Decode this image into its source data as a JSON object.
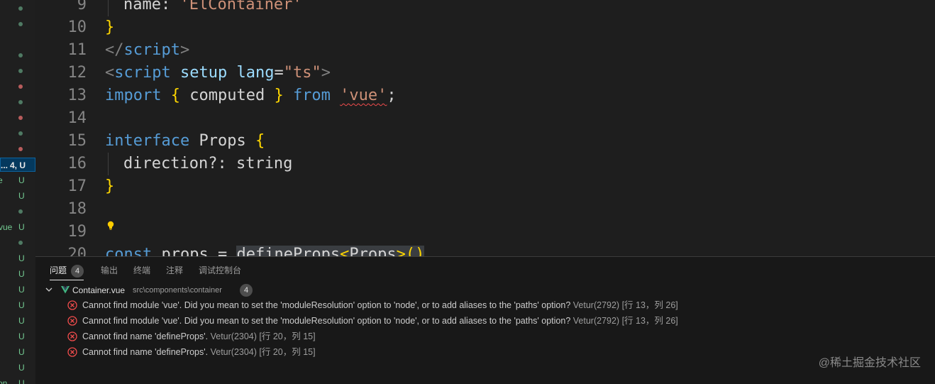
{
  "explorer": {
    "active_item": {
      "name_fragment": "...",
      "status": "4, U"
    },
    "name_fragments": {
      "e": "e",
      "vue": "vue",
      "on": "on"
    },
    "status_u": "U",
    "colors": {
      "untracked": "#73c991",
      "error": "#b85c5c",
      "ok": "#4f7a63"
    }
  },
  "editor": {
    "lines": [
      {
        "n": "9"
      },
      {
        "n": "10"
      },
      {
        "n": "11"
      },
      {
        "n": "12"
      },
      {
        "n": "13"
      },
      {
        "n": "14"
      },
      {
        "n": "15"
      },
      {
        "n": "16"
      },
      {
        "n": "17"
      },
      {
        "n": "18"
      },
      {
        "n": "19"
      },
      {
        "n": "20"
      }
    ],
    "code": {
      "l9_key": "name",
      "l9_colon": ": ",
      "l9_val": "'ElContainer'",
      "l10": "}",
      "l11_open": "</",
      "l11_tag": "script",
      "l11_close": ">",
      "l12_open": "<",
      "l12_tag": "script",
      "l12_attr1": "setup",
      "l12_attr2": "lang",
      "l12_eq": "=",
      "l12_val": "\"ts\"",
      "l12_close": ">",
      "l13_import": "import",
      "l13_lb": "{",
      "l13_name": " computed ",
      "l13_rb": "}",
      "l13_from": "from",
      "l13_mod": "'vue'",
      "l13_semi": ";",
      "l15_kw": "interface",
      "l15_name": "Props",
      "l15_lb": "{",
      "l16_key": "direction?",
      "l16_colon": ": ",
      "l16_type": "string",
      "l17": "}",
      "l20_const": "const",
      "l20_name": "props",
      "l20_eq": " = ",
      "l20_fn": "defineProps",
      "l20_lt": "<",
      "l20_type": "Props",
      "l20_gt": ">",
      "l20_parens": "()"
    },
    "lightbulb_icon": "lightbulb-icon"
  },
  "panel": {
    "tabs": [
      {
        "label": "问题",
        "count": "4",
        "active": true
      },
      {
        "label": "输出"
      },
      {
        "label": "终端"
      },
      {
        "label": "注释"
      },
      {
        "label": "调试控制台"
      }
    ],
    "file": {
      "name": "Container.vue",
      "path": "src\\components\\container",
      "count": "4",
      "icon": "vue-icon"
    },
    "problems": [
      {
        "message": "Cannot find module 'vue'. Did you mean to set the 'moduleResolution' option to 'node', or to add aliases to the 'paths' option?",
        "source": "Vetur(2792)",
        "location": "[行 13，列 26]"
      },
      {
        "message": "Cannot find module 'vue'. Did you mean to set the 'moduleResolution' option to 'node', or to add aliases to the 'paths' option?",
        "source": "Vetur(2792)",
        "location": "[行 13，列 26]"
      },
      {
        "message": "Cannot find name 'defineProps'.",
        "source": "Vetur(2304)",
        "location": "[行 20，列 15]"
      },
      {
        "message": "Cannot find name 'defineProps'.",
        "source": "Vetur(2304)",
        "location": "[行 20，列 15]"
      }
    ],
    "error_color": "#f14c4c"
  },
  "watermark": "@稀土掘金技术社区"
}
